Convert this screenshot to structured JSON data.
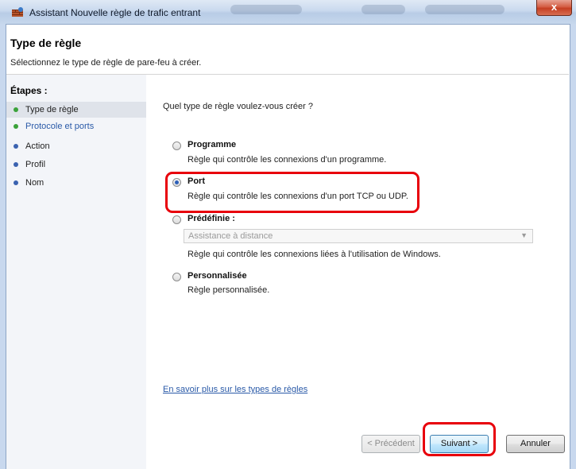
{
  "window": {
    "title": "Assistant Nouvelle règle de trafic entrant",
    "close_label": "x"
  },
  "header": {
    "title": "Type de règle",
    "subtitle": "Sélectionnez le type de règle de pare-feu à créer."
  },
  "steps": {
    "heading": "Étapes :",
    "items": [
      {
        "label": "Type de règle"
      },
      {
        "label": "Protocole et ports"
      },
      {
        "label": "Action"
      },
      {
        "label": "Profil"
      },
      {
        "label": "Nom"
      }
    ]
  },
  "content": {
    "question": "Quel type de règle voulez-vous créer ?",
    "options": [
      {
        "title": "Programme",
        "description": "Règle qui contrôle les connexions d'un programme.",
        "selected": false
      },
      {
        "title": "Port",
        "description": "Règle qui contrôle les connexions d'un port TCP ou UDP.",
        "selected": true
      },
      {
        "title": "Prédéfinie :",
        "description": "Règle qui contrôle les connexions liées à l'utilisation de Windows.",
        "selected": false,
        "dropdown_value": "Assistance à distance"
      },
      {
        "title": "Personnalisée",
        "description": "Règle personnalisée.",
        "selected": false
      }
    ],
    "learn_more_link": "En savoir plus sur les types de règles"
  },
  "buttons": {
    "previous": "< Précédent",
    "next": "Suivant >",
    "cancel": "Annuler"
  },
  "colors": {
    "highlight": "#e8000b",
    "link": "#2a5aa8",
    "step_done": "#3aa23a",
    "step_pending": "#3a62b0"
  },
  "icons": {
    "title": "firewall-wall-icon",
    "close": "close-icon",
    "dropdown": "chevron-down-icon"
  }
}
